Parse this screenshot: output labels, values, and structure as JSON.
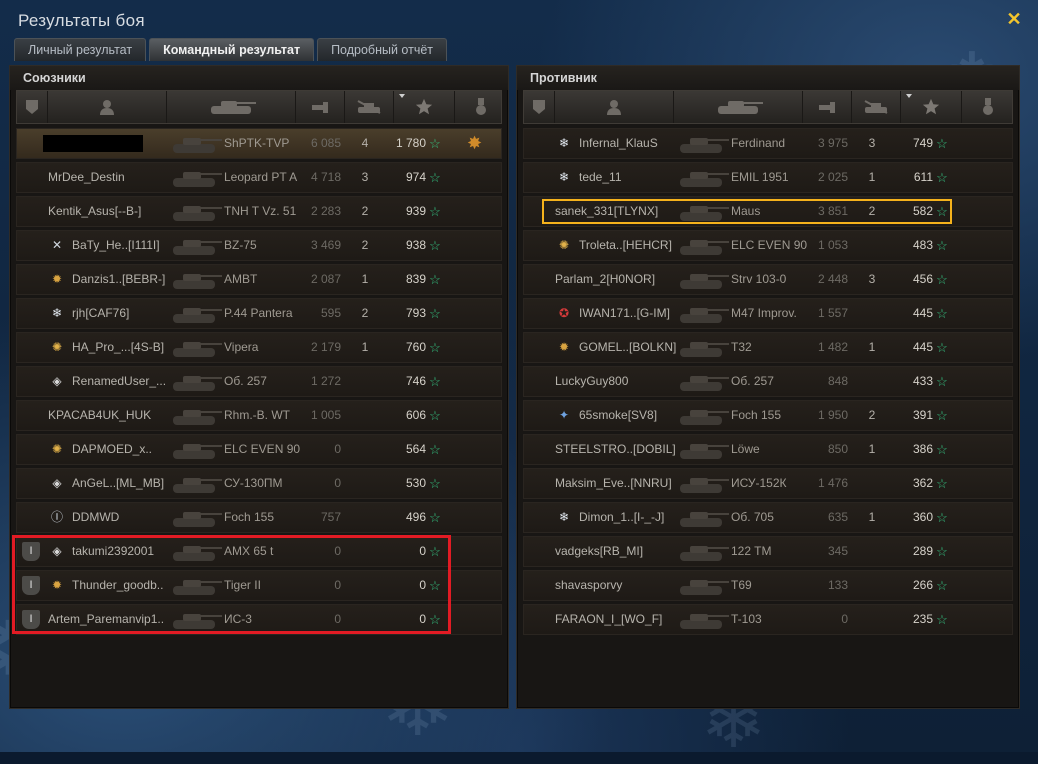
{
  "window": {
    "title": "Результаты боя"
  },
  "tabs": [
    {
      "label": "Личный результат",
      "active": false
    },
    {
      "label": "Командный результат",
      "active": true
    },
    {
      "label": "Подробный отчёт",
      "active": false
    }
  ],
  "allies": {
    "title": "Союзники",
    "rows": [
      {
        "name": "",
        "name_redacted": true,
        "rank_icon": "",
        "squad": "",
        "tank": "ShPTK-TVP",
        "damage": "6 085",
        "kills": "4",
        "xp": "1 780",
        "medal": "medal-icon",
        "me": true
      },
      {
        "name": "MrDee_Destin",
        "rank_icon": "",
        "squad": "",
        "tank": "Leopard PT A",
        "damage": "4 718",
        "kills": "3",
        "xp": "974"
      },
      {
        "name": "Kentik_Asus[--B-]",
        "rank_icon": "",
        "squad": "",
        "tank": "TNH T Vz. 51",
        "damage": "2 283",
        "kills": "2",
        "xp": "939"
      },
      {
        "name": "BaTy_He..[I111I]",
        "rank_icon": "swords-rank-icon",
        "squad": "",
        "tank": "BZ-75",
        "damage": "3 469",
        "kills": "2",
        "xp": "938"
      },
      {
        "name": "Danzis1..[BEBR-]",
        "rank_icon": "star-emblem-rank-icon",
        "squad": "",
        "tank": "AMBT",
        "damage": "2 087",
        "kills": "1",
        "xp": "839"
      },
      {
        "name": "rjh[CAF76]",
        "rank_icon": "snowflake-rank-icon",
        "squad": "",
        "tank": "P.44 Pantera",
        "damage": "595",
        "kills": "2",
        "xp": "793"
      },
      {
        "name": "HA_Pro_...[4S-B]",
        "rank_icon": "golden-rank-icon",
        "squad": "",
        "tank": "Vipera",
        "damage": "2 179",
        "kills": "1",
        "xp": "760"
      },
      {
        "name": "RenamedUser_...",
        "rank_icon": "diamond-rank-icon",
        "squad": "",
        "tank": "Об. 257",
        "damage": "1 272",
        "kills": "",
        "xp": "746"
      },
      {
        "name": "KPACAB4UK_HUK",
        "rank_icon": "",
        "squad": "",
        "tank": "Rhm.-B. WT",
        "damage": "1 005",
        "kills": "",
        "xp": "606"
      },
      {
        "name": "DAPMOED_x..",
        "rank_icon": "golden-rank-icon",
        "squad": "",
        "tank": "ELC EVEN 90",
        "damage": "0",
        "kills": "",
        "xp": "564"
      },
      {
        "name": "AnGeL..[ML_MB]",
        "rank_icon": "diamond-rank-icon",
        "squad": "",
        "tank": "СУ-130ПМ",
        "damage": "0",
        "kills": "",
        "xp": "530"
      },
      {
        "name": "DDMWD",
        "rank_icon": "roman-one-rank-icon",
        "squad": "",
        "tank": "Foch 155",
        "damage": "757",
        "kills": "",
        "xp": "496"
      },
      {
        "name": "takumi2392001",
        "rank_icon": "diamond-rank-icon",
        "squad": "I",
        "tank": "AMX 65 t",
        "damage": "0",
        "kills": "",
        "xp": "0"
      },
      {
        "name": "Thunder_goodb..",
        "rank_icon": "star-emblem-rank-icon",
        "squad": "I",
        "tank": "Tiger II",
        "damage": "0",
        "kills": "",
        "xp": "0"
      },
      {
        "name": "Artem_Paremanvip1..",
        "rank_icon": "",
        "squad": "I",
        "tank": "ИС-3",
        "damage": "0",
        "kills": "",
        "xp": "0"
      }
    ]
  },
  "enemies": {
    "title": "Противник",
    "rows": [
      {
        "name": "Infernal_KlauS",
        "rank_icon": "snowflake-rank-icon",
        "tank": "Ferdinand",
        "damage": "3 975",
        "kills": "3",
        "xp": "749"
      },
      {
        "name": "tede_11",
        "rank_icon": "snowflake-rank-icon",
        "tank": "EMIL 1951",
        "damage": "2 025",
        "kills": "1",
        "xp": "611"
      },
      {
        "name": "sanek_331[TLYNX]",
        "rank_icon": "",
        "tank": "Maus",
        "damage": "3 851",
        "kills": "2",
        "xp": "582"
      },
      {
        "name": "Troleta..[HEHCR]",
        "rank_icon": "golden-rank-icon",
        "tank": "ELC EVEN 90",
        "damage": "1 053",
        "kills": "",
        "xp": "483"
      },
      {
        "name": "Parlam_2[H0NOR]",
        "rank_icon": "",
        "tank": "Strv 103-0",
        "damage": "2 448",
        "kills": "3",
        "xp": "456"
      },
      {
        "name": "IWAN171..[G-IM]",
        "rank_icon": "red-seal-rank-icon",
        "tank": "M47 Improv.",
        "damage": "1 557",
        "kills": "",
        "xp": "445"
      },
      {
        "name": "GOMEL..[BOLKN]",
        "rank_icon": "star-emblem-rank-icon",
        "tank": "T32",
        "damage": "1 482",
        "kills": "1",
        "xp": "445"
      },
      {
        "name": "LuckyGuy800",
        "rank_icon": "",
        "tank": "Об. 257",
        "damage": "848",
        "kills": "",
        "xp": "433"
      },
      {
        "name": "65smoke[SV8]",
        "rank_icon": "blue-rank-icon",
        "tank": "Foch 155",
        "damage": "1 950",
        "kills": "2",
        "xp": "391"
      },
      {
        "name": "STEELSTRO..[DOBIL]",
        "rank_icon": "",
        "tank": "Löwe",
        "damage": "850",
        "kills": "1",
        "xp": "386"
      },
      {
        "name": "Maksim_Eve..[NNRU]",
        "rank_icon": "",
        "tank": "ИСУ-152К",
        "damage": "1 476",
        "kills": "",
        "xp": "362"
      },
      {
        "name": "Dimon_1..[I-_-J]",
        "rank_icon": "snowflake-rank-icon",
        "tank": "Об. 705",
        "damage": "635",
        "kills": "1",
        "xp": "360"
      },
      {
        "name": "vadgeks[RB_MI]",
        "rank_icon": "",
        "tank": "122 TM",
        "damage": "345",
        "kills": "",
        "xp": "289"
      },
      {
        "name": "shavasporvy",
        "rank_icon": "",
        "tank": "T69",
        "damage": "133",
        "kills": "",
        "xp": "266"
      },
      {
        "name": "FARAON_I_[WO_F]",
        "rank_icon": "",
        "tank": "T-103",
        "damage": "0",
        "kills": "",
        "xp": "235"
      }
    ]
  },
  "header_icons": [
    "squad-icon",
    "player-icon",
    "tank-icon",
    "damage-icon",
    "kills-icon",
    "xp-icon",
    "medal-icon"
  ],
  "colors": {
    "accent_red": "#e21b24",
    "accent_gold": "#f5b21c",
    "xp_star": "#34c080",
    "close": "#f3c52c"
  }
}
